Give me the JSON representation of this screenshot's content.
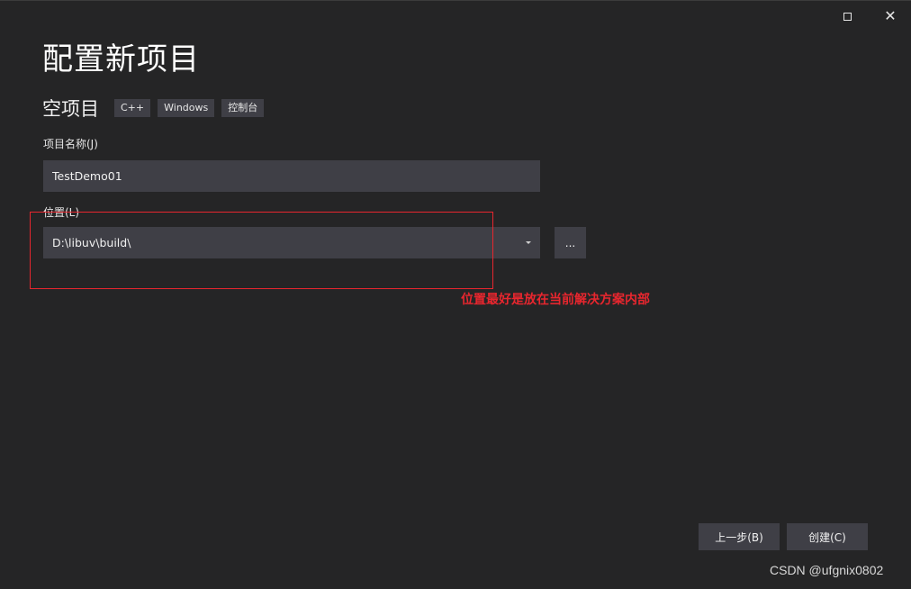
{
  "window": {
    "maximize_icon": "maximize-icon",
    "close_icon": "close-icon",
    "close_glyph": "✕"
  },
  "page": {
    "title": "配置新项目"
  },
  "template": {
    "name": "空项目",
    "tags": [
      "C++",
      "Windows",
      "控制台"
    ]
  },
  "project_name": {
    "label": "项目名称(J)",
    "value": "TestDemo01"
  },
  "location": {
    "label": "位置(L)",
    "value": "D:\\libuv\\build\\",
    "browse_label": "..."
  },
  "annotation": {
    "text": "位置最好是放在当前解决方案内部",
    "color": "#e8262e"
  },
  "footer": {
    "back_label": "上一步(B)",
    "create_label": "创建(C)"
  },
  "watermark": {
    "text": "CSDN @ufgnix0802"
  },
  "colors": {
    "background": "#252526",
    "control": "#3f3f46",
    "text": "#f1f1f1",
    "annotation": "#e8262e"
  }
}
